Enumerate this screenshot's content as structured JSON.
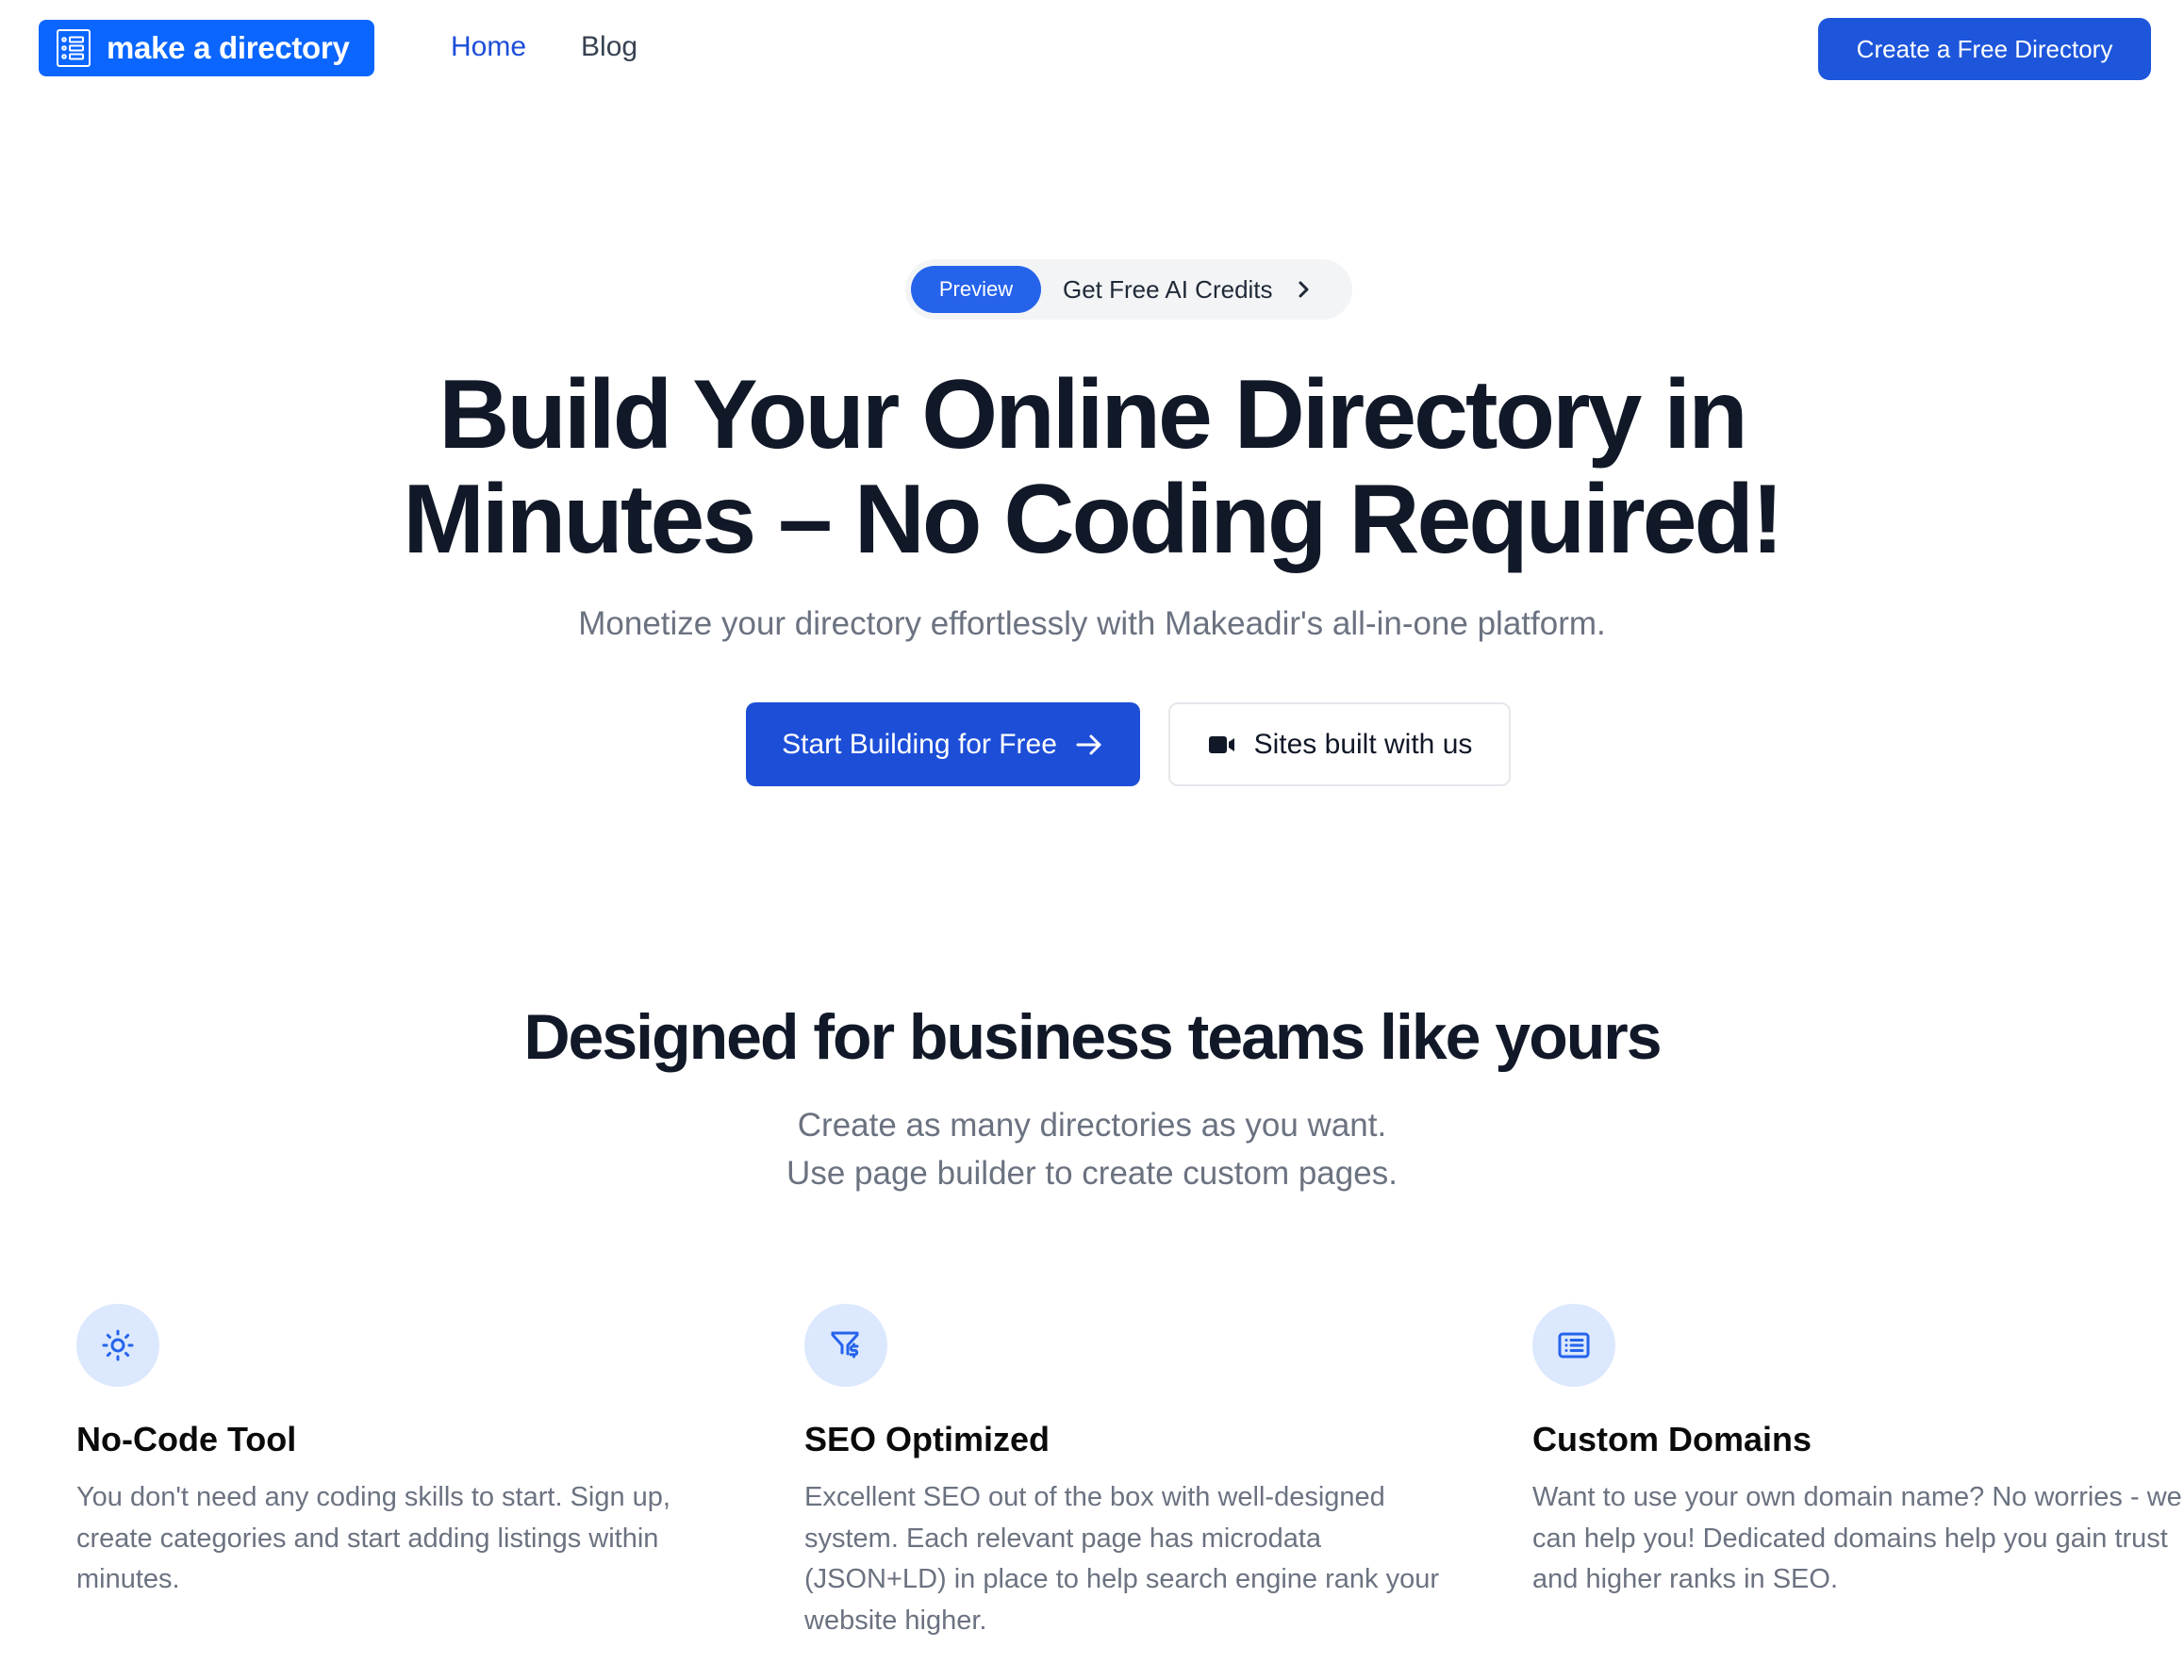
{
  "header": {
    "logo_text": "make a directory",
    "logo_icon": "directory-list-icon",
    "nav": [
      {
        "label": "Home",
        "active": true
      },
      {
        "label": "Blog",
        "active": false
      }
    ],
    "cta_label": "Create a Free Directory"
  },
  "hero": {
    "pill_badge": "Preview",
    "pill_text": "Get Free AI Credits",
    "pill_icon": "chevron-right-icon",
    "title_line1": "Build Your Online Directory in",
    "title_line2": "Minutes – No Coding Required!",
    "subtitle": "Monetize your directory effortlessly with Makeadir's all-in-one platform.",
    "primary_button": "Start Building for Free",
    "primary_icon": "arrow-right-icon",
    "secondary_button": "Sites built with us",
    "secondary_icon": "video-camera-icon"
  },
  "section": {
    "title": "Designed for business teams like yours",
    "subtitle_lines": [
      "Create as many directories as you want.",
      "Use page builder to create custom pages."
    ]
  },
  "features": [
    {
      "icon": "sun-icon",
      "title": "No-Code Tool",
      "body": "You don't need any coding skills to start. Sign up, create categories and start adding listings within minutes."
    },
    {
      "icon": "funnel-dollar-icon",
      "title": "SEO Optimized",
      "body": "Excellent SEO out of the box with well-designed system. Each relevant page has microdata (JSON+LD) in place to help search engine rank your website higher."
    },
    {
      "icon": "list-box-icon",
      "title": "Custom Domains",
      "body": "Want to use your own domain name? No worries - we can help you! Dedicated domains help you gain trust and higher ranks in SEO."
    }
  ],
  "colors": {
    "brand_blue": "#0a66ff",
    "primary_button": "#1d4ed8",
    "cta_button": "#1d56db",
    "badge_blue": "#2563eb",
    "icon_bg": "#dbe8fe",
    "heading": "#111827",
    "muted_text": "#6b7280"
  }
}
